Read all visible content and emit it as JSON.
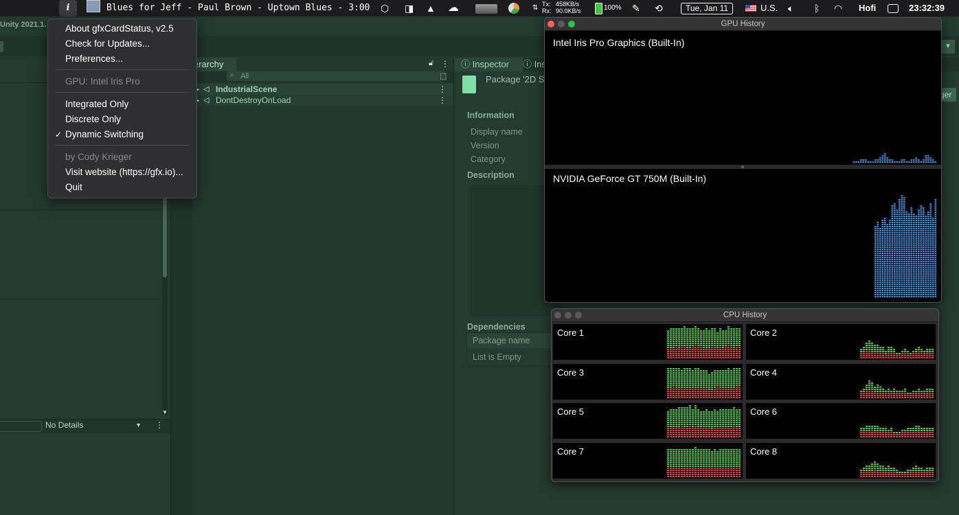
{
  "menubar": {
    "info_icon": "i",
    "now_playing": "Blues for Jeff - Paul Brown - Uptown Blues - 3:00",
    "net_tx_label": "Tx:",
    "net_tx": "458KB/s",
    "net_rx_label": "Rx:",
    "net_rx": "90.0KB/s",
    "battery": "100%",
    "date": "Tue, Jan 11",
    "input_source": "U.S.",
    "user": "Hofi",
    "time": "23:32:39"
  },
  "unity": {
    "title": "Unity 2021.1.",
    "hierarchy_tab": "erarchy",
    "search_placeholder": "All",
    "hierarchy_items": [
      "IndustrialScene",
      "DontDestroyOnLoad"
    ],
    "inspector_tab": "Inspector",
    "inspector_tab2": "Ins",
    "package_title": "Package '2D S",
    "information_header": "Information",
    "fields": [
      "Display name",
      "Version",
      "Category"
    ],
    "description_header": "Description",
    "dependencies_header": "Dependencies",
    "deps_column": "Package name",
    "deps_empty": "List is Empty",
    "no_details": "No Details",
    "right_tag": "ger"
  },
  "gfx_menu": {
    "items": [
      {
        "label": "About gfxCardStatus, v2.5",
        "enabled": true
      },
      {
        "label": "Check for Updates...",
        "enabled": true
      },
      {
        "label": "Preferences...",
        "enabled": true
      },
      {
        "label": "GPU: Intel Iris Pro",
        "enabled": false
      },
      {
        "label": "Integrated Only",
        "enabled": true
      },
      {
        "label": "Discrete Only",
        "enabled": true
      },
      {
        "label": "Dynamic Switching",
        "enabled": true,
        "checked": true
      },
      {
        "label": "by Cody Krieger",
        "enabled": false
      },
      {
        "label": "Visit website (https://gfx.io)...",
        "enabled": true
      },
      {
        "label": "Quit",
        "enabled": true
      }
    ],
    "checkmark": "✓"
  },
  "gpu_window": {
    "title": "GPU History",
    "gpus": [
      {
        "name": "Intel Iris Pro Graphics (Built-In)",
        "history": [
          1,
          1,
          1,
          2,
          2,
          2,
          1,
          1,
          1,
          2,
          2,
          3,
          4,
          5,
          3,
          2,
          2,
          1,
          1,
          1,
          2,
          2,
          1,
          1,
          2,
          2,
          3,
          2,
          1,
          2,
          4,
          4,
          3,
          2,
          1
        ]
      },
      {
        "name": "NVIDIA GeForce GT 750M (Built-In)",
        "history": [
          35,
          37,
          34,
          38,
          39,
          36,
          38,
          45,
          46,
          43,
          48,
          50,
          49,
          42,
          41,
          44,
          41,
          40,
          43,
          45,
          44,
          40,
          42,
          46,
          39,
          48
        ]
      }
    ],
    "bar_color": "#3f8fdc"
  },
  "cpu_window": {
    "title": "CPU History",
    "user_color": "#3ec93e",
    "system_color": "#d93a3a",
    "cores": [
      {
        "name": "Core 1",
        "system": [
          5,
          5,
          5,
          6,
          5,
          6,
          6,
          5,
          5,
          6,
          7,
          6,
          6,
          5,
          5,
          5,
          6,
          6,
          5,
          6,
          5,
          6,
          7,
          6,
          5,
          6,
          6
        ],
        "user": [
          9,
          10,
          10,
          9,
          10,
          9,
          10,
          10,
          10,
          9,
          9,
          9,
          8,
          9,
          10,
          9,
          9,
          9,
          8,
          9,
          9,
          8,
          9,
          9,
          10,
          9,
          9
        ]
      },
      {
        "name": "Core 2",
        "system": [
          3,
          3,
          4,
          4,
          3,
          3,
          3,
          3,
          3,
          2,
          3,
          3,
          3,
          2,
          2,
          3,
          3,
          3,
          2,
          3,
          3,
          4,
          3,
          3,
          3,
          3,
          3
        ],
        "user": [
          2,
          3,
          4,
          5,
          5,
          4,
          4,
          3,
          3,
          2,
          3,
          3,
          2,
          1,
          1,
          1,
          2,
          1,
          1,
          1,
          2,
          2,
          2,
          1,
          2,
          2,
          2
        ]
      },
      {
        "name": "Core 3",
        "system": [
          5,
          5,
          6,
          5,
          5,
          5,
          5,
          5,
          5,
          5,
          5,
          5,
          5,
          5,
          5,
          4,
          4,
          5,
          6,
          5,
          5,
          5,
          5,
          5,
          5,
          6,
          6
        ],
        "user": [
          10,
          10,
          9,
          10,
          10,
          9,
          10,
          10,
          10,
          9,
          10,
          10,
          9,
          9,
          9,
          8,
          9,
          9,
          8,
          9,
          9,
          9,
          10,
          9,
          10,
          9,
          9
        ]
      },
      {
        "name": "Core 4",
        "system": [
          3,
          3,
          4,
          4,
          4,
          3,
          3,
          3,
          3,
          3,
          3,
          3,
          3,
          3,
          3,
          3,
          3,
          2,
          2,
          3,
          3,
          3,
          3,
          3,
          3,
          3,
          3
        ],
        "user": [
          1,
          2,
          3,
          5,
          4,
          3,
          4,
          3,
          2,
          1,
          2,
          1,
          2,
          1,
          1,
          1,
          2,
          1,
          1,
          1,
          1,
          2,
          1,
          1,
          2,
          2,
          2
        ]
      },
      {
        "name": "Core 5",
        "system": [
          5,
          5,
          5,
          5,
          5,
          6,
          5,
          5,
          6,
          5,
          6,
          5,
          5,
          5,
          5,
          5,
          4,
          5,
          5,
          5,
          5,
          5,
          5,
          5,
          6,
          5,
          5
        ],
        "user": [
          8,
          9,
          9,
          9,
          10,
          9,
          10,
          10,
          10,
          9,
          10,
          9,
          8,
          8,
          9,
          8,
          9,
          9,
          8,
          9,
          9,
          9,
          9,
          9,
          9,
          9,
          9
        ]
      },
      {
        "name": "Core 6",
        "system": [
          3,
          3,
          3,
          3,
          4,
          3,
          3,
          3,
          3,
          3,
          3,
          3,
          2,
          2,
          2,
          3,
          3,
          3,
          3,
          3,
          3,
          3,
          3,
          3,
          3,
          3,
          3
        ],
        "user": [
          2,
          2,
          3,
          3,
          2,
          3,
          3,
          2,
          2,
          2,
          1,
          2,
          1,
          1,
          1,
          1,
          1,
          2,
          2,
          2,
          3,
          3,
          2,
          2,
          2,
          2,
          2
        ]
      },
      {
        "name": "Core 7",
        "system": [
          5,
          5,
          5,
          5,
          5,
          5,
          5,
          5,
          5,
          5,
          5,
          5,
          5,
          5,
          5,
          5,
          5,
          5,
          5,
          5,
          5,
          5,
          5,
          5,
          5,
          5,
          5
        ],
        "user": [
          9,
          9,
          9,
          9,
          9,
          9,
          9,
          9,
          9,
          9,
          10,
          9,
          9,
          9,
          9,
          9,
          8,
          9,
          8,
          9,
          9,
          9,
          9,
          9,
          9,
          9,
          9
        ]
      },
      {
        "name": "Core 8",
        "system": [
          3,
          3,
          3,
          3,
          3,
          4,
          3,
          3,
          3,
          3,
          3,
          3,
          3,
          2,
          2,
          2,
          2,
          2,
          3,
          3,
          3,
          3,
          3,
          3,
          3,
          3,
          3
        ],
        "user": [
          1,
          2,
          3,
          3,
          4,
          4,
          4,
          3,
          3,
          2,
          3,
          2,
          2,
          2,
          1,
          1,
          1,
          2,
          1,
          2,
          3,
          2,
          2,
          1,
          2,
          2,
          2
        ]
      }
    ]
  }
}
